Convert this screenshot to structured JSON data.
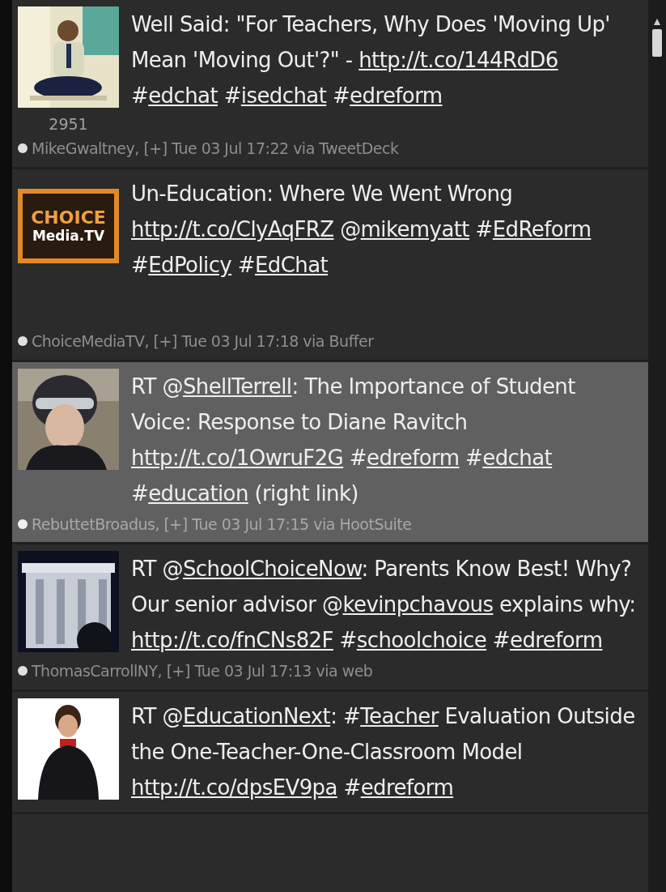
{
  "tweets": [
    {
      "selected": false,
      "avatar": {
        "kind": "picture"
      },
      "count": "2951",
      "parts": [
        {
          "kind": "text",
          "text": "Well Said: \"For Teachers, Why Does 'Moving Up' Mean 'Moving Out'?\" - "
        },
        {
          "kind": "link",
          "text": "http://t.co/144RdD6"
        },
        {
          "kind": "text",
          "text": " #"
        },
        {
          "kind": "link",
          "text": "edchat"
        },
        {
          "kind": "text",
          "text": " #"
        },
        {
          "kind": "link",
          "text": "isedchat"
        },
        {
          "kind": "text",
          "text": " #"
        },
        {
          "kind": "link",
          "text": "edreform"
        }
      ],
      "meta": "MikeGwaltney, [+] Tue 03 Jul 17:22 via TweetDeck"
    },
    {
      "selected": false,
      "avatar": {
        "kind": "logo",
        "lines": [
          "CHOICE",
          "Media.TV"
        ]
      },
      "parts": [
        {
          "kind": "text",
          "text": "Un-Education: Where We Went Wrong "
        },
        {
          "kind": "link",
          "text": "http://t.co/ClyAqFRZ"
        },
        {
          "kind": "text",
          "text": " @"
        },
        {
          "kind": "link",
          "text": "mikemyatt"
        },
        {
          "kind": "text",
          "text": " #"
        },
        {
          "kind": "link",
          "text": "EdReform"
        },
        {
          "kind": "text",
          "text": " #"
        },
        {
          "kind": "link",
          "text": "EdPolicy"
        },
        {
          "kind": "text",
          "text": " #"
        },
        {
          "kind": "link",
          "text": "EdChat"
        }
      ],
      "meta": "ChoiceMediaTV, [+] Tue 03 Jul 17:18 via Buffer"
    },
    {
      "selected": true,
      "avatar": {
        "kind": "picture"
      },
      "parts": [
        {
          "kind": "text",
          "text": "RT @"
        },
        {
          "kind": "link",
          "text": "ShellTerrell"
        },
        {
          "kind": "text",
          "text": ": The Importance of Student Voice: Response to Diane Ravitch "
        },
        {
          "kind": "link",
          "text": "http://t.co/1OwruF2G"
        },
        {
          "kind": "text",
          "text": " #"
        },
        {
          "kind": "link",
          "text": "edreform"
        },
        {
          "kind": "text",
          "text": " #"
        },
        {
          "kind": "link",
          "text": "edchat"
        },
        {
          "kind": "text",
          "text": " #"
        },
        {
          "kind": "link",
          "text": "education"
        },
        {
          "kind": "text",
          "text": " (right link)"
        }
      ],
      "meta": "RebuttetBroadus, [+] Tue 03 Jul 17:15 via HootSuite"
    },
    {
      "selected": false,
      "avatar": {
        "kind": "picture"
      },
      "parts": [
        {
          "kind": "text",
          "text": "RT @"
        },
        {
          "kind": "link",
          "text": "SchoolChoiceNow"
        },
        {
          "kind": "text",
          "text": ": Parents Know Best! Why? Our senior advisor @"
        },
        {
          "kind": "link",
          "text": "kevinpchavous"
        },
        {
          "kind": "text",
          "text": " explains why: "
        },
        {
          "kind": "link",
          "text": "http://t.co/fnCNs82F"
        },
        {
          "kind": "text",
          "text": " #"
        },
        {
          "kind": "link",
          "text": "schoolchoice"
        },
        {
          "kind": "text",
          "text": " #"
        },
        {
          "kind": "link",
          "text": "edreform"
        }
      ],
      "meta": "ThomasCarrollNY, [+] Tue 03 Jul 17:13 via web"
    },
    {
      "selected": false,
      "avatar": {
        "kind": "picture"
      },
      "parts": [
        {
          "kind": "text",
          "text": "RT @"
        },
        {
          "kind": "link",
          "text": "EducationNext"
        },
        {
          "kind": "text",
          "text": ": #"
        },
        {
          "kind": "link",
          "text": "Teacher"
        },
        {
          "kind": "text",
          "text": " Evaluation Outside the One-Teacher-One-Classroom Model "
        },
        {
          "kind": "link",
          "text": "http://t.co/dpsEV9pa"
        },
        {
          "kind": "text",
          "text": " #"
        },
        {
          "kind": "link",
          "text": "edreform"
        }
      ]
    }
  ]
}
